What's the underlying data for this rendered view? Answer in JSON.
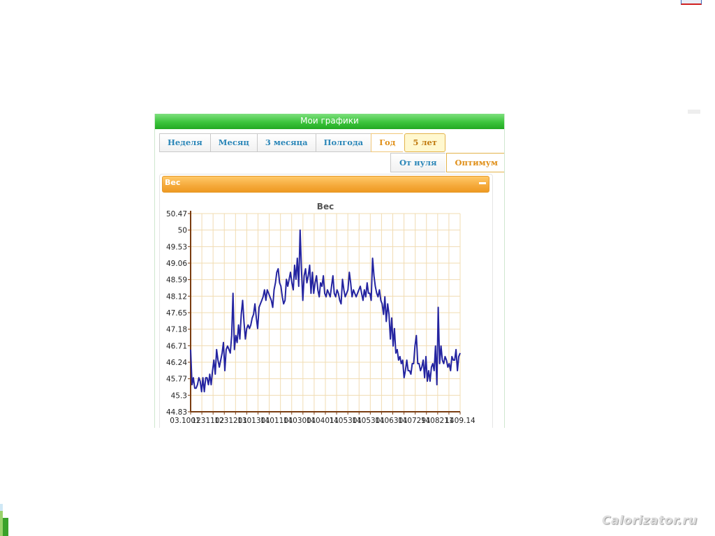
{
  "panel": {
    "title": "Мои графики"
  },
  "range_tabs": [
    "Неделя",
    "Месяц",
    "3 месяца",
    "Полгода",
    "Год",
    "5 лет"
  ],
  "scale_tabs": [
    "От нуля",
    "Оптимум"
  ],
  "widget": {
    "title": "Вес"
  },
  "watermark": "Calorizator.ru",
  "colors": {
    "series": "#2424a0",
    "grid": "#f1dcb2",
    "axis": "#7a3d12",
    "header_green": "#3cc43c",
    "header_orange": "#f5a93a"
  },
  "chart_data": {
    "type": "line",
    "title": "Вес",
    "xlabel": "",
    "ylabel": "",
    "ylim": [
      44.83,
      50.47
    ],
    "yticks": [
      "50.47",
      "50",
      "49.53",
      "49.06",
      "48.59",
      "48.12",
      "47.65",
      "47.18",
      "46.71",
      "46.24",
      "45.77",
      "45.3",
      "44.83"
    ],
    "xticks": [
      "03.1001",
      "1231102",
      "1231201",
      "1301301",
      "1401101",
      "1403001",
      "1404011",
      "1405301",
      "1405301",
      "1406301",
      "1407291",
      "1408211",
      "1409.14"
    ],
    "series": [
      {
        "values": [
          46.6,
          45.6,
          45.8,
          45.5,
          45.5,
          45.6,
          45.8,
          45.7,
          45.4,
          45.8,
          45.4,
          45.8,
          45.8,
          45.6,
          45.9,
          45.6,
          46.0,
          46.3,
          45.9,
          46.6,
          46.3,
          46.1,
          46.3,
          46.5,
          46.8,
          46.0,
          46.6,
          46.7,
          46.6,
          46.5,
          47.0,
          48.2,
          46.6,
          47.0,
          46.8,
          47.3,
          46.9,
          47.6,
          48.0,
          47.4,
          46.9,
          47.2,
          47.3,
          47.2,
          47.3,
          47.5,
          47.6,
          47.9,
          47.5,
          47.2,
          47.8,
          47.9,
          48.0,
          48.1,
          48.3,
          48.0,
          48.3,
          48.2,
          48.1,
          48.0,
          47.8,
          48.3,
          48.5,
          48.8,
          48.9,
          48.5,
          48.4,
          48.1,
          47.9,
          48.0,
          48.6,
          48.4,
          48.6,
          48.8,
          48.5,
          48.3,
          49.0,
          48.6,
          49.2,
          48.4,
          50.0,
          48.9,
          48.0,
          48.7,
          48.9,
          48.5,
          48.7,
          49.0,
          48.2,
          48.8,
          48.2,
          48.5,
          48.7,
          48.3,
          48.1,
          48.5,
          48.4,
          48.7,
          48.2,
          48.1,
          48.3,
          48.2,
          48.1,
          48.4,
          48.7,
          48.2,
          48.1,
          48.3,
          48.2,
          48.0,
          47.9,
          48.6,
          48.3,
          48.1,
          48.2,
          48.3,
          48.8,
          48.5,
          48.1,
          48.3,
          48.2,
          48.1,
          48.2,
          48.3,
          48.4,
          48.2,
          48.0,
          48.3,
          48.1,
          48.5,
          48.2,
          48.2,
          48.0,
          49.2,
          48.7,
          48.4,
          48.2,
          48.1,
          48.3,
          48.0,
          47.9,
          47.6,
          48.1,
          47.4,
          47.9,
          47.6,
          46.9,
          47.5,
          46.7,
          47.2,
          46.5,
          46.6,
          46.3,
          46.4,
          46.2,
          46.3,
          45.8,
          46.0,
          46.3,
          46.0,
          46.0,
          45.9,
          46.2,
          46.2,
          46.7,
          47.0,
          46.2,
          46.2,
          46.0,
          46.1,
          46.3,
          45.8,
          46.4,
          45.7,
          46.0,
          45.7,
          46.1,
          46.2,
          46.0,
          46.7,
          45.6,
          47.8,
          46.2,
          46.7,
          46.3,
          46.2,
          46.4,
          46.3,
          46.1,
          46.2,
          46.0,
          46.4,
          46.3,
          46.3,
          46.6,
          46.0,
          46.4,
          46.5
        ]
      }
    ],
    "grid": true,
    "legend": "none"
  }
}
